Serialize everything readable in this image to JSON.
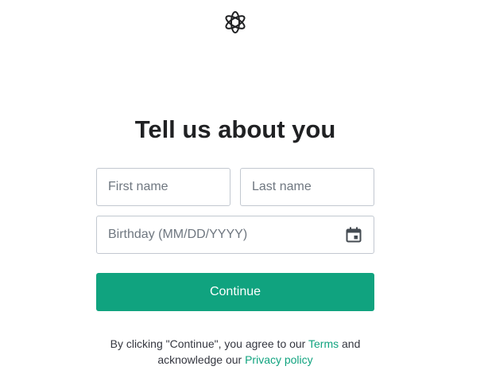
{
  "brand": {
    "logo_icon": "openai-logo-icon",
    "accent_color": "#10a37f"
  },
  "heading": "Tell us about you",
  "form": {
    "first_name": {
      "placeholder": "First name",
      "value": ""
    },
    "last_name": {
      "placeholder": "Last name",
      "value": ""
    },
    "birthday": {
      "placeholder": "Birthday (MM/DD/YYYY)",
      "value": "",
      "icon": "calendar-icon"
    },
    "continue_label": "Continue"
  },
  "legal": {
    "prefix": "By clicking \"Continue\", you agree to our",
    "terms_link": "Terms",
    "middle": "and acknowledge our",
    "privacy_link": "Privacy policy"
  }
}
